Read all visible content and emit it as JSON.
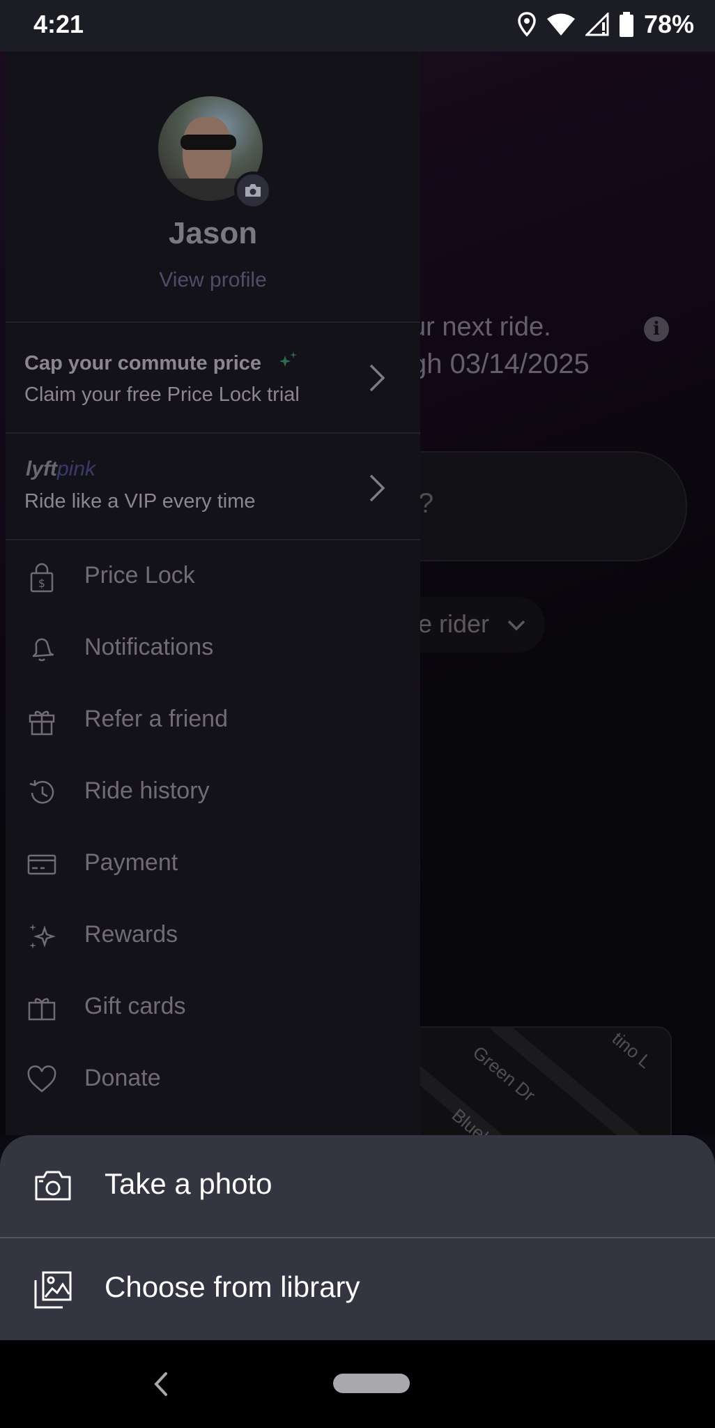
{
  "status_bar": {
    "time": "4:21",
    "battery": "78%"
  },
  "background": {
    "line1": "ur next ride.",
    "line2": "gh 03/14/2025",
    "pill_text": "?",
    "rider_text": "e rider",
    "map_labels": [
      "Green Dr",
      "Bluehav",
      "tino L"
    ]
  },
  "drawer": {
    "name": "Jason",
    "view_profile": "View profile",
    "promo1": {
      "title": "Cap your commute price",
      "subtitle": "Claim your free Price Lock trial"
    },
    "promo2": {
      "logo_a": "lyft",
      "logo_b": "pink",
      "subtitle": "Ride like a VIP every time"
    },
    "menu": [
      {
        "label": "Price Lock",
        "icon": "lock-dollar-icon"
      },
      {
        "label": "Notifications",
        "icon": "bell-icon"
      },
      {
        "label": "Refer a friend",
        "icon": "gift-icon"
      },
      {
        "label": "Ride history",
        "icon": "history-icon"
      },
      {
        "label": "Payment",
        "icon": "card-icon"
      },
      {
        "label": "Rewards",
        "icon": "sparkle-icon"
      },
      {
        "label": "Gift cards",
        "icon": "gift-card-icon"
      },
      {
        "label": "Donate",
        "icon": "heart-icon"
      }
    ]
  },
  "sheet": {
    "take_photo": "Take a photo",
    "choose_library": "Choose from library"
  }
}
